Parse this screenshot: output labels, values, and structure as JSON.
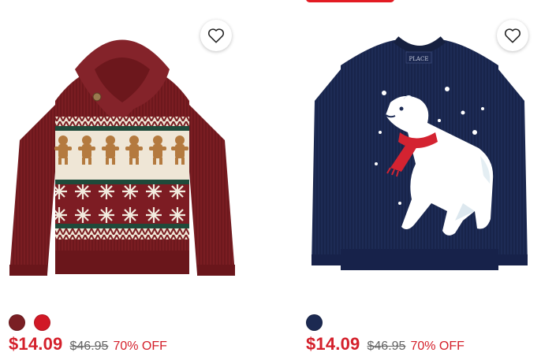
{
  "colors": {
    "accent": "#e31b23",
    "sale": "#d4202b",
    "original": "#666666"
  },
  "products": [
    {
      "image": "burgundy shawl-collar fair isle sweater with gingerbread men and snowflakes",
      "swatches": [
        {
          "color": "#7a1f24"
        },
        {
          "color": "#d11926"
        }
      ],
      "sale_price": "$14.09",
      "original_price": "$46.95",
      "discount": "70% OFF"
    },
    {
      "image": "navy sweater with polar bear wearing red scarf in snow",
      "brand_tag": "PLACE",
      "swatches": [
        {
          "color": "#1c2a52"
        }
      ],
      "sale_price": "$14.09",
      "original_price": "$46.95",
      "discount": "70% OFF"
    }
  ]
}
